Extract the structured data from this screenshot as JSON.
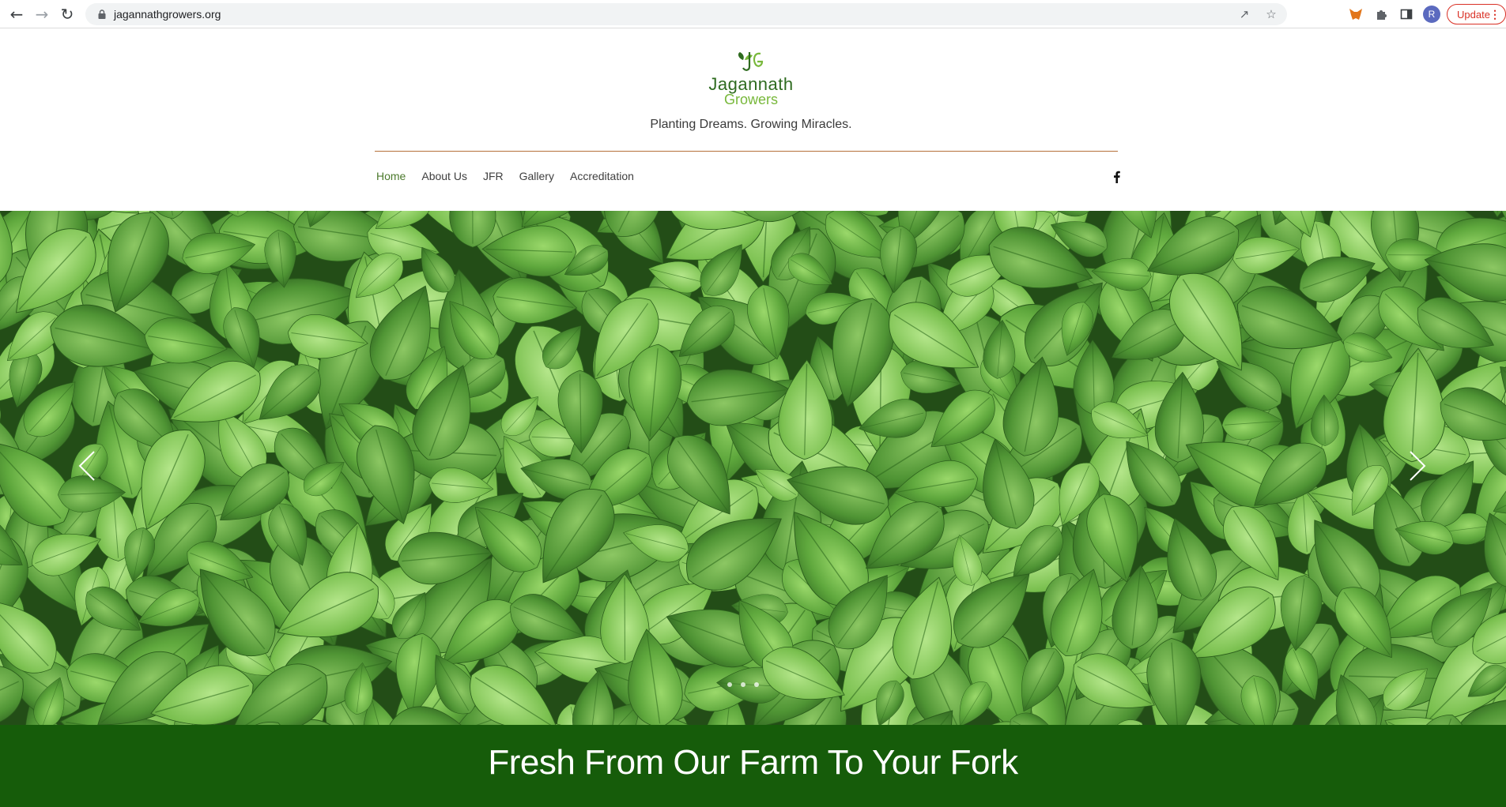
{
  "browser": {
    "url": "jagannathgrowers.org",
    "profile_initial": "R",
    "update_label": "Update"
  },
  "site": {
    "logo_line1": "Jagannath",
    "logo_line2": "Growers",
    "tagline": "Planting Dreams. Growing Miracles.",
    "menu": [
      {
        "label": "Home",
        "active": true
      },
      {
        "label": "About Us"
      },
      {
        "label": "JFR"
      },
      {
        "label": "Gallery"
      },
      {
        "label": "Accreditation"
      }
    ],
    "social_icon": "facebook-icon"
  },
  "hero": {
    "slide_count": 3,
    "current_slide": 1
  },
  "banner": {
    "text": "Fresh From Our Farm To Your Fork"
  },
  "colors": {
    "brand_dark_green": "#165c0a",
    "logo_green": "#2e6b1f",
    "logo_light_green": "#78b83b",
    "divider": "#b5703a",
    "update_red": "#d93025"
  }
}
